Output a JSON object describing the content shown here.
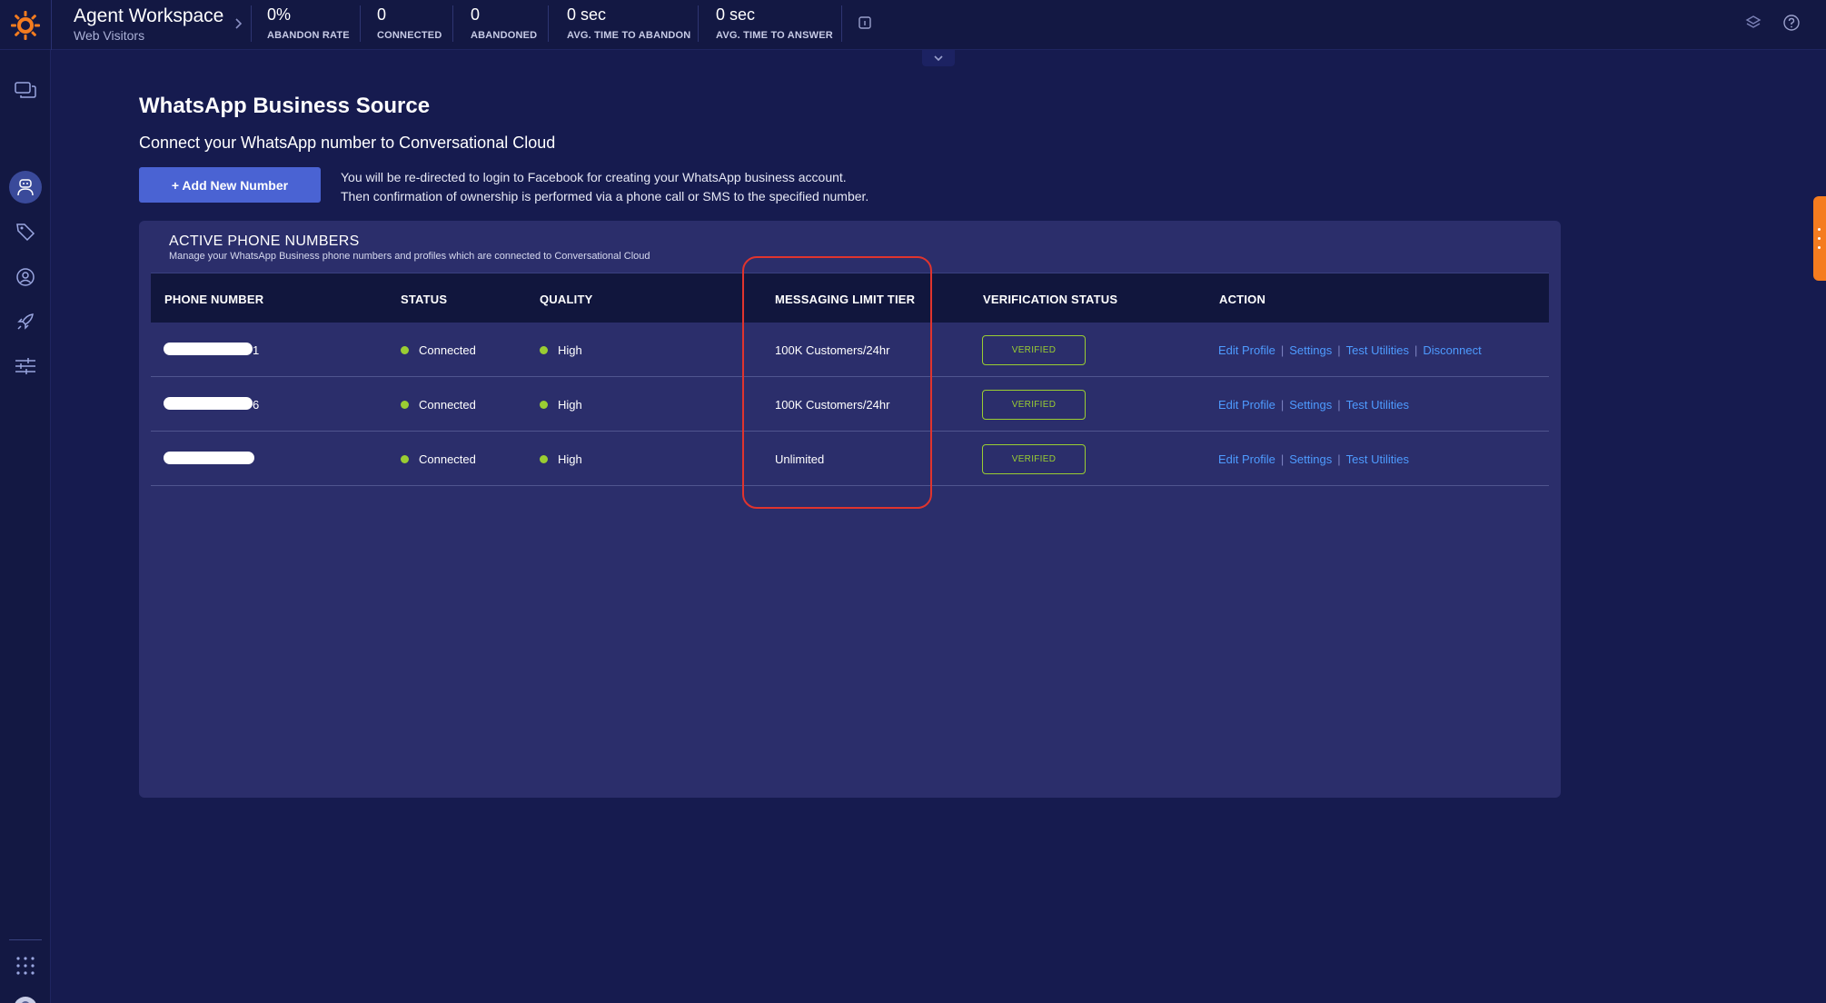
{
  "header": {
    "app_title": "Agent Workspace",
    "app_subtitle": "Web Visitors",
    "kpis": [
      {
        "value": "0%",
        "label": "ABANDON RATE"
      },
      {
        "value": "0",
        "label": "CONNECTED"
      },
      {
        "value": "0",
        "label": "ABANDONED"
      },
      {
        "value": "0 sec",
        "label": "AVG. TIME TO ABANDON"
      },
      {
        "value": "0 sec",
        "label": "AVG. TIME TO ANSWER"
      }
    ],
    "icons": [
      "info-icon",
      "layers-icon",
      "help-icon"
    ]
  },
  "sidebar": {
    "items": [
      {
        "icon": "conversations-icon"
      },
      {
        "icon": "bot-icon",
        "active": true
      },
      {
        "icon": "tags-icon"
      },
      {
        "icon": "user-circle-icon"
      },
      {
        "icon": "rocket-icon"
      },
      {
        "icon": "sliders-icon"
      },
      {
        "icon": "apps-grid-icon"
      },
      {
        "icon": "avatar-icon"
      }
    ]
  },
  "main": {
    "title": "WhatsApp Business Source",
    "subtitle": "Connect your WhatsApp number to Conversational Cloud",
    "add_button_label": "+ Add New Number",
    "info_line_1": "You will be re-directed to login to Facebook for creating your WhatsApp business account.",
    "info_line_2": "Then confirmation of ownership is performed via a phone call or SMS to the specified number."
  },
  "panel": {
    "title": "ACTIVE PHONE NUMBERS",
    "description": "Manage your WhatsApp Business phone numbers and profiles which are connected to Conversational Cloud",
    "columns": [
      "PHONE NUMBER",
      "STATUS",
      "QUALITY",
      "MESSAGING LIMIT TIER",
      "VERIFICATION STATUS",
      "ACTION"
    ],
    "rows": [
      {
        "phone_suffix": "1",
        "status": "Connected",
        "quality": "High",
        "tier": "100K Customers/24hr",
        "verification": "VERIFIED",
        "actions": [
          "Edit Profile",
          "Settings",
          "Test Utilities",
          "Disconnect"
        ]
      },
      {
        "phone_suffix": "6",
        "status": "Connected",
        "quality": "High",
        "tier": "100K Customers/24hr",
        "verification": "VERIFIED",
        "actions": [
          "Edit Profile",
          "Settings",
          "Test Utilities"
        ]
      },
      {
        "phone_suffix": "",
        "status": "Connected",
        "quality": "High",
        "tier": "Unlimited",
        "verification": "VERIFIED",
        "actions": [
          "Edit Profile",
          "Settings",
          "Test Utilities"
        ]
      }
    ]
  },
  "colors": {
    "background": "#161b4f",
    "panel": "#2b2e6b",
    "accent_button": "#4a63d3",
    "link": "#4e9bff",
    "status_green": "#9acd32",
    "highlight_red": "#e0342e",
    "orange_handle": "#f57c1f"
  }
}
